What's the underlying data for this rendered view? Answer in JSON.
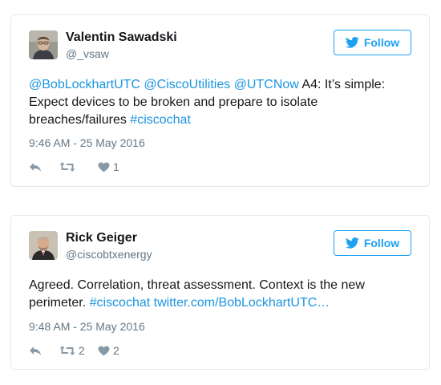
{
  "tweets": [
    {
      "name": "Valentin Sawadski",
      "handle": "@_vsaw",
      "follow_label": "Follow",
      "text": [
        {
          "t": "@BobLockhartUTC",
          "link": true
        },
        {
          "t": " ",
          "link": false
        },
        {
          "t": "@CiscoUtilities",
          "link": true
        },
        {
          "t": " ",
          "link": false
        },
        {
          "t": "@UTCNow",
          "link": true
        },
        {
          "t": " A4: It’s simple: Expect devices to be broken and prepare to isolate breaches/failures ",
          "link": false
        },
        {
          "t": "#ciscochat",
          "link": true
        }
      ],
      "timestamp": "9:46 AM - 25 May 2016",
      "retweets": "",
      "likes": "1"
    },
    {
      "name": "Rick Geiger",
      "handle": "@ciscobtxenergy",
      "follow_label": "Follow",
      "text": [
        {
          "t": "Agreed. Correlation, threat assessment. Context is the new perimeter. ",
          "link": false
        },
        {
          "t": "#ciscochat",
          "link": true
        },
        {
          "t": " ",
          "link": false
        },
        {
          "t": "twitter.com/BobLockhartUTC…",
          "link": true
        }
      ],
      "timestamp": "9:48 AM - 25 May 2016",
      "retweets": "2",
      "likes": "2"
    }
  ],
  "colors": {
    "link": "#1b95e0",
    "follow": "#1da1f2",
    "muted": "#657786",
    "icon": "#8899a6",
    "border": "#e1e8ed"
  },
  "icons": {
    "follow": "twitter-bird-icon",
    "reply": "reply-icon",
    "retweet": "retweet-icon",
    "like": "heart-icon"
  }
}
